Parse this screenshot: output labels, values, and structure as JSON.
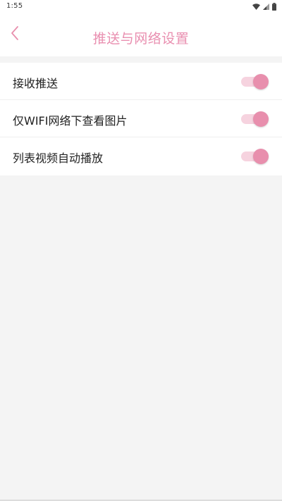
{
  "status_bar": {
    "time": "1:55",
    "icons": [
      "wifi-icon",
      "signal-icon",
      "battery-icon"
    ]
  },
  "header": {
    "title": "推送与网络设置",
    "back_icon": "chevron-left-icon"
  },
  "settings": [
    {
      "label": "接收推送",
      "enabled": true
    },
    {
      "label": "仅WIFI网络下查看图片",
      "enabled": true
    },
    {
      "label": "列表视频自动播放",
      "enabled": true
    }
  ],
  "colors": {
    "accent": "#e88fad",
    "accent_light": "#f6d3df",
    "background": "#f4f4f4"
  }
}
